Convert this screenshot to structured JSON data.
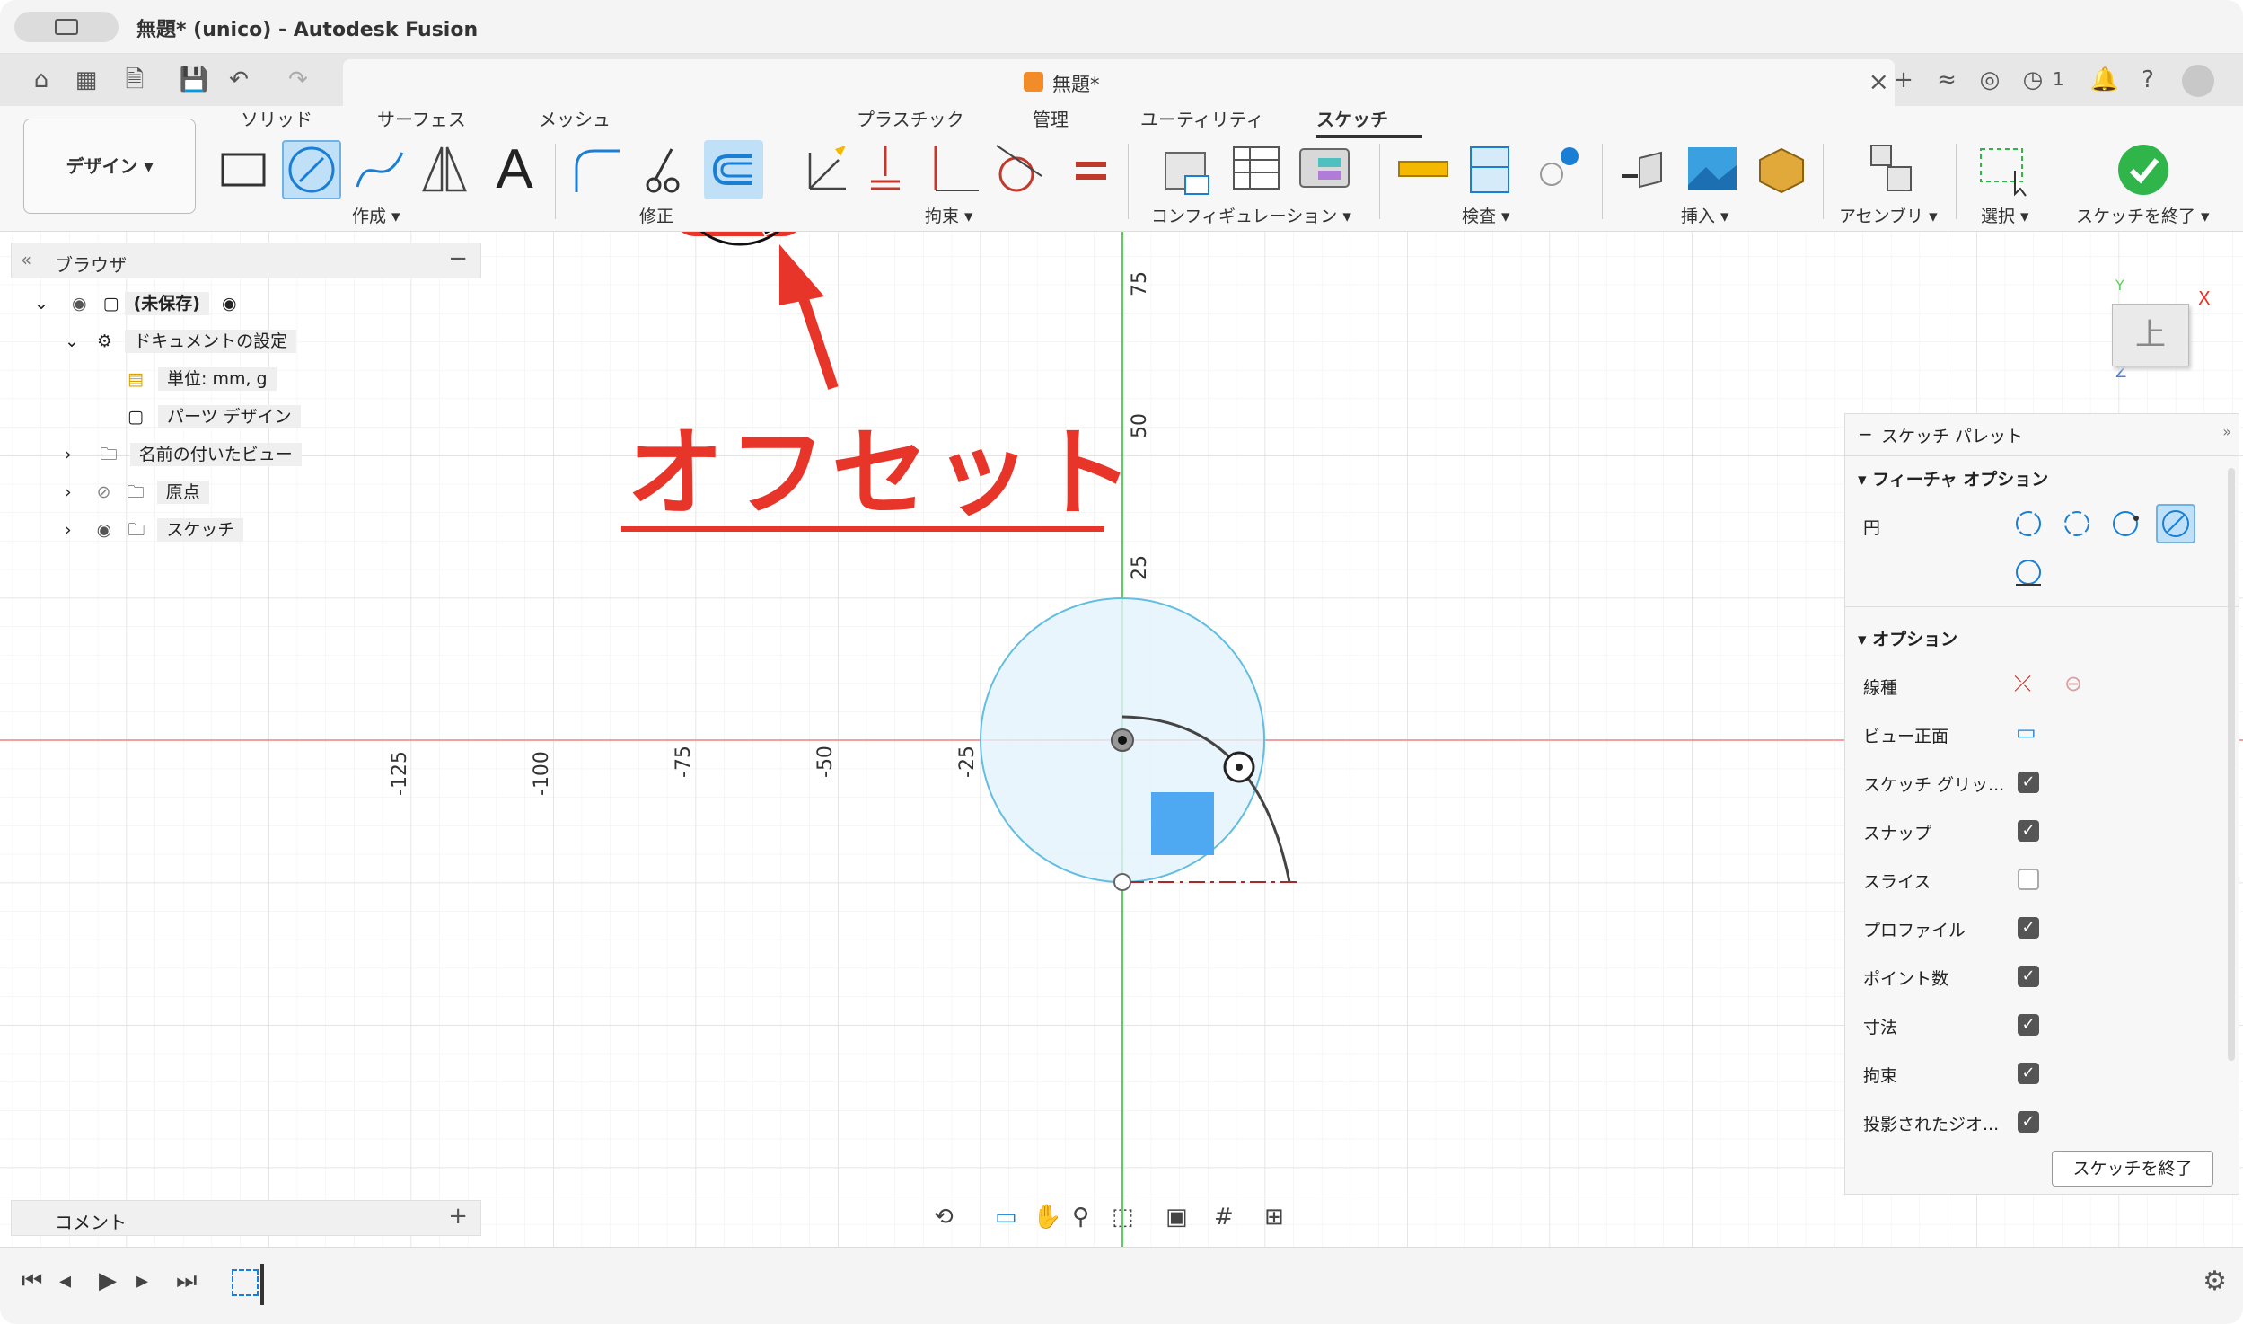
{
  "window": {
    "title": "無題* (unico) - Autodesk Fusion"
  },
  "document_tab": {
    "label": "無題*"
  },
  "tabbar": {
    "job_count": "1"
  },
  "ribbon": {
    "tabs": [
      {
        "label": "ソリッド"
      },
      {
        "label": "サーフェス"
      },
      {
        "label": "メッシュ"
      },
      {
        "label": "プラスチック"
      },
      {
        "label": "管理"
      },
      {
        "label": "ユーティリティ"
      },
      {
        "label": "スケッチ"
      }
    ],
    "workspace": "デザイン",
    "groups": {
      "create": "作成",
      "modify": "修正",
      "constraints": "拘束",
      "configuration": "コンフィギュレーション",
      "inspect": "検査",
      "insert": "挿入",
      "assemble": "アセンブリ",
      "select": "選択",
      "finish": "スケッチを終了"
    }
  },
  "browser": {
    "title": "ブラウザ",
    "items": [
      {
        "label": "(未保存)"
      },
      {
        "label": "ドキュメントの設定"
      },
      {
        "label": "単位: mm, g"
      },
      {
        "label": "パーツ デザイン"
      },
      {
        "label": "名前の付いたビュー"
      },
      {
        "label": "原点"
      },
      {
        "label": "スケッチ"
      }
    ]
  },
  "comments": {
    "title": "コメント"
  },
  "viewcube": {
    "face": "上",
    "axis_x": "X",
    "axis_y": "Y",
    "axis_z": "Z"
  },
  "axis_labels": {
    "vertical": [
      "75",
      "50",
      "25"
    ],
    "horizontal": [
      "-125",
      "-100",
      "-75",
      "-50",
      "-25"
    ]
  },
  "annotation": {
    "text": "オフセット"
  },
  "palette": {
    "title": "スケッチ パレット",
    "feature_options": "フィーチャ オプション",
    "circle_label": "円",
    "options_title": "オプション",
    "options": [
      {
        "label": "線種",
        "kind": "icon"
      },
      {
        "label": "ビュー正面",
        "kind": "icon"
      },
      {
        "label": "スケッチ グリッ...",
        "checked": true
      },
      {
        "label": "スナップ",
        "checked": true
      },
      {
        "label": "スライス",
        "checked": false
      },
      {
        "label": "プロファイル",
        "checked": true
      },
      {
        "label": "ポイント数",
        "checked": true
      },
      {
        "label": "寸法",
        "checked": true
      },
      {
        "label": "拘束",
        "checked": true
      },
      {
        "label": "投影されたジオ...",
        "checked": true
      }
    ],
    "finish_button": "スケッチを終了"
  },
  "colors": {
    "accent": "#1a7fd4",
    "annotation": "#e8352a",
    "finish_green": "#2fb54a",
    "x_axis": "#f2a0a0",
    "y_axis": "#5ad05a"
  }
}
